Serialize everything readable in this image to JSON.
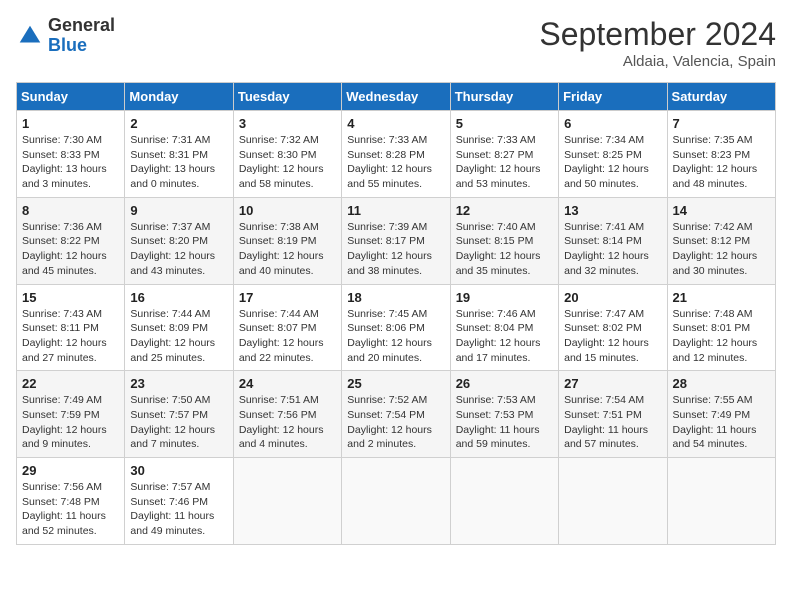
{
  "header": {
    "logo": {
      "general": "General",
      "blue": "Blue"
    },
    "title": "September 2024",
    "location": "Aldaia, Valencia, Spain"
  },
  "calendar": {
    "days_of_week": [
      "Sunday",
      "Monday",
      "Tuesday",
      "Wednesday",
      "Thursday",
      "Friday",
      "Saturday"
    ],
    "weeks": [
      [
        null,
        {
          "day": 2,
          "sunrise": "7:31 AM",
          "sunset": "8:31 PM",
          "daylight": "13 hours and 0 minutes."
        },
        {
          "day": 3,
          "sunrise": "7:32 AM",
          "sunset": "8:30 PM",
          "daylight": "12 hours and 58 minutes."
        },
        {
          "day": 4,
          "sunrise": "7:33 AM",
          "sunset": "8:28 PM",
          "daylight": "12 hours and 55 minutes."
        },
        {
          "day": 5,
          "sunrise": "7:33 AM",
          "sunset": "8:27 PM",
          "daylight": "12 hours and 53 minutes."
        },
        {
          "day": 6,
          "sunrise": "7:34 AM",
          "sunset": "8:25 PM",
          "daylight": "12 hours and 50 minutes."
        },
        {
          "day": 7,
          "sunrise": "7:35 AM",
          "sunset": "8:23 PM",
          "daylight": "12 hours and 48 minutes."
        }
      ],
      [
        {
          "day": 1,
          "sunrise": "7:30 AM",
          "sunset": "8:33 PM",
          "daylight": "13 hours and 3 minutes."
        },
        {
          "day": 8,
          "sunrise": "7:36 AM",
          "sunset": "8:22 PM",
          "daylight": "12 hours and 45 minutes."
        },
        {
          "day": 9,
          "sunrise": "7:37 AM",
          "sunset": "8:20 PM",
          "daylight": "12 hours and 43 minutes."
        },
        {
          "day": 10,
          "sunrise": "7:38 AM",
          "sunset": "8:19 PM",
          "daylight": "12 hours and 40 minutes."
        },
        {
          "day": 11,
          "sunrise": "7:39 AM",
          "sunset": "8:17 PM",
          "daylight": "12 hours and 38 minutes."
        },
        {
          "day": 12,
          "sunrise": "7:40 AM",
          "sunset": "8:15 PM",
          "daylight": "12 hours and 35 minutes."
        },
        {
          "day": 13,
          "sunrise": "7:41 AM",
          "sunset": "8:14 PM",
          "daylight": "12 hours and 32 minutes."
        },
        {
          "day": 14,
          "sunrise": "7:42 AM",
          "sunset": "8:12 PM",
          "daylight": "12 hours and 30 minutes."
        }
      ],
      [
        {
          "day": 15,
          "sunrise": "7:43 AM",
          "sunset": "8:11 PM",
          "daylight": "12 hours and 27 minutes."
        },
        {
          "day": 16,
          "sunrise": "7:44 AM",
          "sunset": "8:09 PM",
          "daylight": "12 hours and 25 minutes."
        },
        {
          "day": 17,
          "sunrise": "7:44 AM",
          "sunset": "8:07 PM",
          "daylight": "12 hours and 22 minutes."
        },
        {
          "day": 18,
          "sunrise": "7:45 AM",
          "sunset": "8:06 PM",
          "daylight": "12 hours and 20 minutes."
        },
        {
          "day": 19,
          "sunrise": "7:46 AM",
          "sunset": "8:04 PM",
          "daylight": "12 hours and 17 minutes."
        },
        {
          "day": 20,
          "sunrise": "7:47 AM",
          "sunset": "8:02 PM",
          "daylight": "12 hours and 15 minutes."
        },
        {
          "day": 21,
          "sunrise": "7:48 AM",
          "sunset": "8:01 PM",
          "daylight": "12 hours and 12 minutes."
        }
      ],
      [
        {
          "day": 22,
          "sunrise": "7:49 AM",
          "sunset": "7:59 PM",
          "daylight": "12 hours and 9 minutes."
        },
        {
          "day": 23,
          "sunrise": "7:50 AM",
          "sunset": "7:57 PM",
          "daylight": "12 hours and 7 minutes."
        },
        {
          "day": 24,
          "sunrise": "7:51 AM",
          "sunset": "7:56 PM",
          "daylight": "12 hours and 4 minutes."
        },
        {
          "day": 25,
          "sunrise": "7:52 AM",
          "sunset": "7:54 PM",
          "daylight": "12 hours and 2 minutes."
        },
        {
          "day": 26,
          "sunrise": "7:53 AM",
          "sunset": "7:53 PM",
          "daylight": "11 hours and 59 minutes."
        },
        {
          "day": 27,
          "sunrise": "7:54 AM",
          "sunset": "7:51 PM",
          "daylight": "11 hours and 57 minutes."
        },
        {
          "day": 28,
          "sunrise": "7:55 AM",
          "sunset": "7:49 PM",
          "daylight": "11 hours and 54 minutes."
        }
      ],
      [
        {
          "day": 29,
          "sunrise": "7:56 AM",
          "sunset": "7:48 PM",
          "daylight": "11 hours and 52 minutes."
        },
        {
          "day": 30,
          "sunrise": "7:57 AM",
          "sunset": "7:46 PM",
          "daylight": "11 hours and 49 minutes."
        },
        null,
        null,
        null,
        null,
        null
      ]
    ]
  }
}
